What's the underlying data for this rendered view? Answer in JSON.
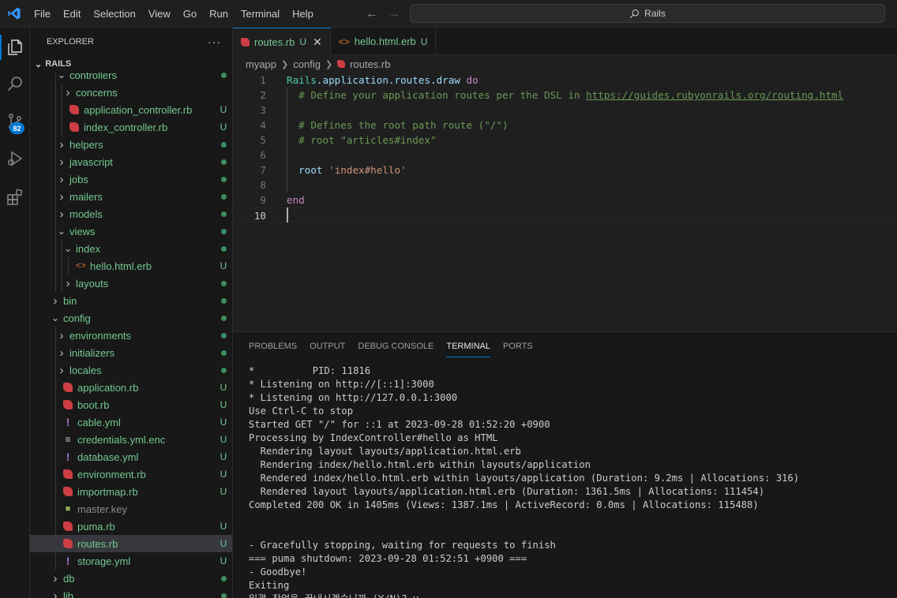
{
  "titlebar": {
    "menu": [
      "File",
      "Edit",
      "Selection",
      "View",
      "Go",
      "Run",
      "Terminal",
      "Help"
    ],
    "search_text": "Rails",
    "back_icon": "arrow-left-icon",
    "forward_icon": "arrow-right-icon"
  },
  "activity_bar": {
    "items": [
      "explorer-icon",
      "search-icon",
      "source-control-icon",
      "run-debug-icon",
      "extensions-icon"
    ],
    "scm_badge": "82"
  },
  "explorer": {
    "title": "EXPLORER",
    "more": "···",
    "section": "RAILS",
    "tree": [
      {
        "label": "controllers",
        "type": "folder",
        "open": true,
        "depth": 2,
        "color": "green",
        "status": "dot"
      },
      {
        "label": "concerns",
        "type": "folder",
        "open": false,
        "depth": 3,
        "color": "green",
        "status": ""
      },
      {
        "label": "application_controller.rb",
        "type": "ruby",
        "depth": 3,
        "color": "green",
        "status": "U"
      },
      {
        "label": "index_controller.rb",
        "type": "ruby",
        "depth": 3,
        "color": "green",
        "status": "U"
      },
      {
        "label": "helpers",
        "type": "folder",
        "open": false,
        "depth": 2,
        "color": "green",
        "status": "dot"
      },
      {
        "label": "javascript",
        "type": "folder",
        "open": false,
        "depth": 2,
        "color": "green",
        "status": "dot"
      },
      {
        "label": "jobs",
        "type": "folder",
        "open": false,
        "depth": 2,
        "color": "green",
        "status": "dot"
      },
      {
        "label": "mailers",
        "type": "folder",
        "open": false,
        "depth": 2,
        "color": "green",
        "status": "dot"
      },
      {
        "label": "models",
        "type": "folder",
        "open": false,
        "depth": 2,
        "color": "green",
        "status": "dot"
      },
      {
        "label": "views",
        "type": "folder",
        "open": true,
        "depth": 2,
        "color": "green",
        "status": "dot"
      },
      {
        "label": "index",
        "type": "folder",
        "open": true,
        "depth": 3,
        "color": "green",
        "status": "dot"
      },
      {
        "label": "hello.html.erb",
        "type": "html",
        "depth": 4,
        "color": "green",
        "status": "U"
      },
      {
        "label": "layouts",
        "type": "folder",
        "open": false,
        "depth": 3,
        "color": "green",
        "status": "dot"
      },
      {
        "label": "bin",
        "type": "folder",
        "open": false,
        "depth": 1,
        "color": "green",
        "status": "dot"
      },
      {
        "label": "config",
        "type": "folder",
        "open": true,
        "depth": 1,
        "color": "green",
        "status": "dot"
      },
      {
        "label": "environments",
        "type": "folder",
        "open": false,
        "depth": 2,
        "color": "green",
        "status": "dot"
      },
      {
        "label": "initializers",
        "type": "folder",
        "open": false,
        "depth": 2,
        "color": "green",
        "status": "dot"
      },
      {
        "label": "locales",
        "type": "folder",
        "open": false,
        "depth": 2,
        "color": "green",
        "status": "dot"
      },
      {
        "label": "application.rb",
        "type": "ruby",
        "depth": 2,
        "color": "green",
        "status": "U"
      },
      {
        "label": "boot.rb",
        "type": "ruby",
        "depth": 2,
        "color": "green",
        "status": "U"
      },
      {
        "label": "cable.yml",
        "type": "yaml",
        "depth": 2,
        "color": "green",
        "status": "U"
      },
      {
        "label": "credentials.yml.enc",
        "type": "lines",
        "depth": 2,
        "color": "green",
        "status": "U"
      },
      {
        "label": "database.yml",
        "type": "yaml",
        "depth": 2,
        "color": "green",
        "status": "U"
      },
      {
        "label": "environment.rb",
        "type": "ruby",
        "depth": 2,
        "color": "green",
        "status": "U"
      },
      {
        "label": "importmap.rb",
        "type": "ruby",
        "depth": 2,
        "color": "green",
        "status": "U"
      },
      {
        "label": "master.key",
        "type": "lock",
        "depth": 2,
        "color": "gray",
        "status": ""
      },
      {
        "label": "puma.rb",
        "type": "ruby",
        "depth": 2,
        "color": "green",
        "status": "U"
      },
      {
        "label": "routes.rb",
        "type": "ruby",
        "depth": 2,
        "color": "green",
        "status": "U",
        "selected": true
      },
      {
        "label": "storage.yml",
        "type": "yaml",
        "depth": 2,
        "color": "green",
        "status": "U"
      },
      {
        "label": "db",
        "type": "folder",
        "open": false,
        "depth": 1,
        "color": "green",
        "status": "dot"
      },
      {
        "label": "lib",
        "type": "folder",
        "open": false,
        "depth": 1,
        "color": "green",
        "status": "dot"
      }
    ]
  },
  "tabs": [
    {
      "label": "routes.rb",
      "status": "U",
      "active": true,
      "icon": "ruby-file-icon"
    },
    {
      "label": "hello.html.erb",
      "status": "U",
      "active": false,
      "icon": "html-file-icon"
    }
  ],
  "breadcrumb": [
    "myapp",
    "config",
    "routes.rb"
  ],
  "editor": {
    "current_line": 10,
    "lines": [
      [
        {
          "t": "Rails",
          "c": "const"
        },
        {
          "t": ".application.routes.draw ",
          "c": "method"
        },
        {
          "t": "do",
          "c": "kw"
        }
      ],
      [
        {
          "t": "  # Define your application routes per the DSL in ",
          "c": "comment"
        },
        {
          "t": "https://guides.rubyonrails.org/routing.html",
          "c": "link"
        }
      ],
      [],
      [
        {
          "t": "  # Defines the root path route (\"/\")",
          "c": "comment"
        }
      ],
      [
        {
          "t": "  # root \"articles#index\"",
          "c": "comment"
        }
      ],
      [],
      [
        {
          "t": "  ",
          "c": "plain"
        },
        {
          "t": "root",
          "c": "method"
        },
        {
          "t": " ",
          "c": "plain"
        },
        {
          "t": "'index#hello'",
          "c": "str"
        }
      ],
      [],
      [
        {
          "t": "end",
          "c": "kw"
        }
      ],
      []
    ]
  },
  "panel": {
    "tabs": [
      "PROBLEMS",
      "OUTPUT",
      "DEBUG CONSOLE",
      "TERMINAL",
      "PORTS"
    ],
    "active_tab": "TERMINAL",
    "terminal_lines": [
      "*          PID: 11816",
      "* Listening on http://[::1]:3000",
      "* Listening on http://127.0.0.1:3000",
      "Use Ctrl-C to stop",
      "Started GET \"/\" for ::1 at 2023-09-28 01:52:20 +0900",
      "Processing by IndexController#hello as HTML",
      "  Rendering layout layouts/application.html.erb",
      "  Rendering index/hello.html.erb within layouts/application",
      "  Rendered index/hello.html.erb within layouts/application (Duration: 9.2ms | Allocations: 316)",
      "  Rendered layout layouts/application.html.erb (Duration: 1361.5ms | Allocations: 111454)",
      "Completed 200 OK in 1405ms (Views: 1387.1ms | ActiveRecord: 0.0ms | Allocations: 115488)",
      "",
      "",
      "- Gracefully stopping, waiting for requests to finish",
      "=== puma shutdown: 2023-09-28 01:52:51 +0900 ===",
      "- Goodbye!",
      "Exiting",
      "일괄 작업을 끝내시겠습니까 (Y/N)? y"
    ]
  },
  "colors": {
    "accent": "#0078d4",
    "untracked": "#73c991",
    "ruby": "#cc3e44"
  }
}
